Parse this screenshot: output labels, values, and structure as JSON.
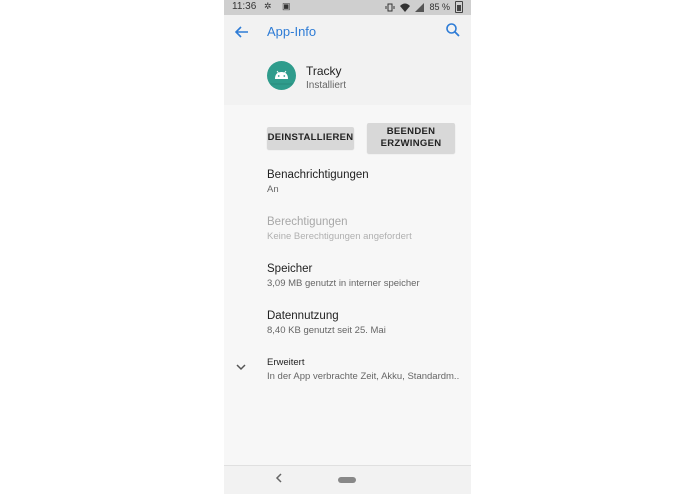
{
  "status_bar": {
    "time": "11:36",
    "left_icons": "✲ ▣",
    "battery": "85 %"
  },
  "app_bar": {
    "title": "App-Info"
  },
  "app": {
    "name": "Tracky",
    "status": "Installiert"
  },
  "buttons": {
    "uninstall": "DEINSTALLIEREN",
    "force_stop_line1": "BEENDEN",
    "force_stop_line2": "ERZWINGEN"
  },
  "items": [
    {
      "title": "Benachrichtigungen",
      "subtitle": "An"
    },
    {
      "title": "Berechtigungen",
      "subtitle": "Keine Berechtigungen angefordert"
    },
    {
      "title": "Speicher",
      "subtitle": "3,09 MB genutzt in interner speicher"
    },
    {
      "title": "Datennutzung",
      "subtitle": "8,40 KB genutzt seit 25. Mai"
    },
    {
      "title": "Erweitert",
      "subtitle": "In der App verbrachte Zeit, Akku, Standardm.."
    }
  ],
  "colors": {
    "accent": "#2e7cd6",
    "app_icon": "#2f9c8c"
  },
  "icons": {
    "back": "arrow-left-icon",
    "search": "search-icon",
    "android": "android-icon",
    "chevron": "chevron-down-icon"
  }
}
